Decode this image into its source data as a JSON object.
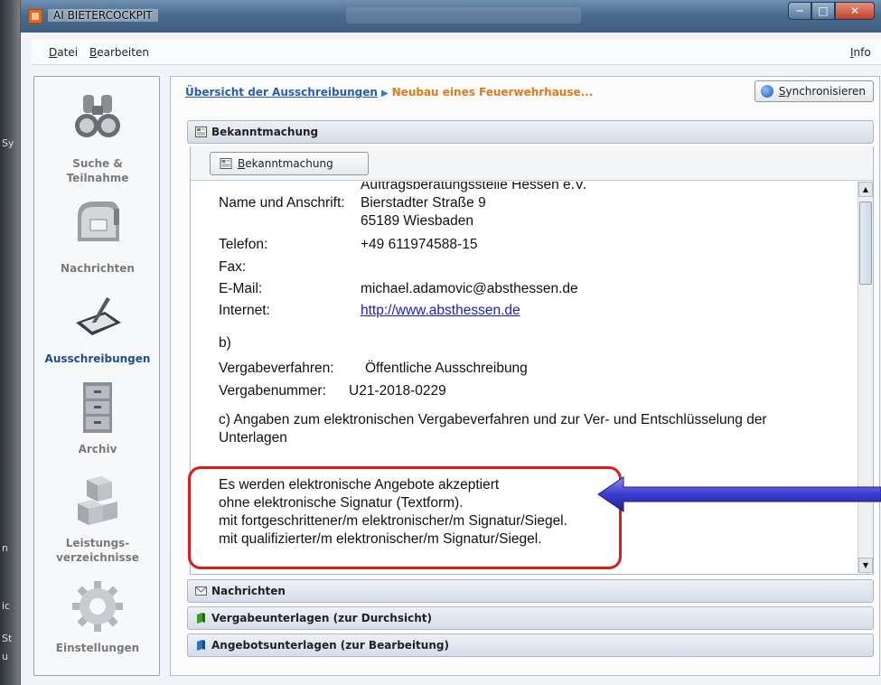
{
  "window": {
    "title": "AI BIETERCOCKPIT"
  },
  "menu": {
    "datei_pre": "",
    "datei_u": "D",
    "datei_post": "atei",
    "bearbeiten_pre": "",
    "bearbeiten_u": "B",
    "bearbeiten_post": "earbeiten",
    "info_pre": "",
    "info_u": "I",
    "info_post": "nfo"
  },
  "sidebar": {
    "items": [
      {
        "label_line1": "Suche &",
        "label_line2": "Teilnahme",
        "icon": "binoculars-icon"
      },
      {
        "label_line1": "Nachrichten",
        "label_line2": "",
        "icon": "mailbox-icon"
      },
      {
        "label_line1": "Ausschreibungen",
        "label_line2": "",
        "icon": "tablet-pen-icon",
        "active": true
      },
      {
        "label_line1": "Archiv",
        "label_line2": "",
        "icon": "file-cabinet-icon"
      },
      {
        "label_line1": "Leistungs-",
        "label_line2": "verzeichnisse",
        "icon": "cubes-icon"
      },
      {
        "label_line1": "Einstellungen",
        "label_line2": "",
        "icon": "gear-icon"
      }
    ]
  },
  "breadcrumb": {
    "link": "Übersicht der Ausschreibungen",
    "current": "Neubau eines Feuerwehrhause..."
  },
  "sync_button": {
    "u": "S",
    "rest": "ynchronisieren"
  },
  "sections": {
    "bekanntmachung": "Bekanntmachung",
    "nachrichten": "Nachrichten",
    "vergabeunterlagen": "Vergabeunterlagen (zur Durchsicht)",
    "angebotsunterlagen": "Angebotsunterlagen (zur Bearbeitung)"
  },
  "bek_tab": {
    "u": "B",
    "rest": "ekanntmachung"
  },
  "document": {
    "org_line": "Auftragsberatungsstelle Hessen e.V.",
    "name_label": "Name und Anschrift:",
    "street": "Bierstadter Straße 9",
    "city": "65189 Wiesbaden",
    "telefon_label": "Telefon:",
    "telefon_value": "+49 611974588-15",
    "fax_label": "Fax:",
    "email_label": "E-Mail:",
    "email_value": "michael.adamovic@absthessen.de",
    "internet_label": "Internet:",
    "internet_value": "http://www.absthessen.de",
    "b_heading": "b)",
    "vergabeverfahren_label": "Vergabeverfahren:",
    "vergabeverfahren_value": "Öffentliche Ausschreibung",
    "vergabenummer_label": "Vergabenummer:",
    "vergabenummer_value": "U21-2018-0229",
    "c_line1": "c) Angaben zum elektronischen Vergabeverfahren und zur Ver- und Entschlüsselung der",
    "c_line2": "Unterlagen",
    "accept_line1": "Es werden elektronische Angebote akzeptiert",
    "accept_line2": "ohne elektronische Signatur (Textform).",
    "accept_line3": "mit fortgeschrittener/m elektronischer/m Signatur/Siegel.",
    "accept_line4": "mit qualifizierter/m elektronischer/m Signatur/Siegel."
  },
  "desk_strip": [
    "Sy",
    "n",
    "ic",
    "St",
    "u"
  ],
  "colors": {
    "accent_link": "#2a5db0",
    "breadcrumb_current": "#e27a1a",
    "active_nav": "#1f4e8c",
    "highlight": "#e01a1a",
    "annotation_arrow": "#3a3ad0"
  }
}
